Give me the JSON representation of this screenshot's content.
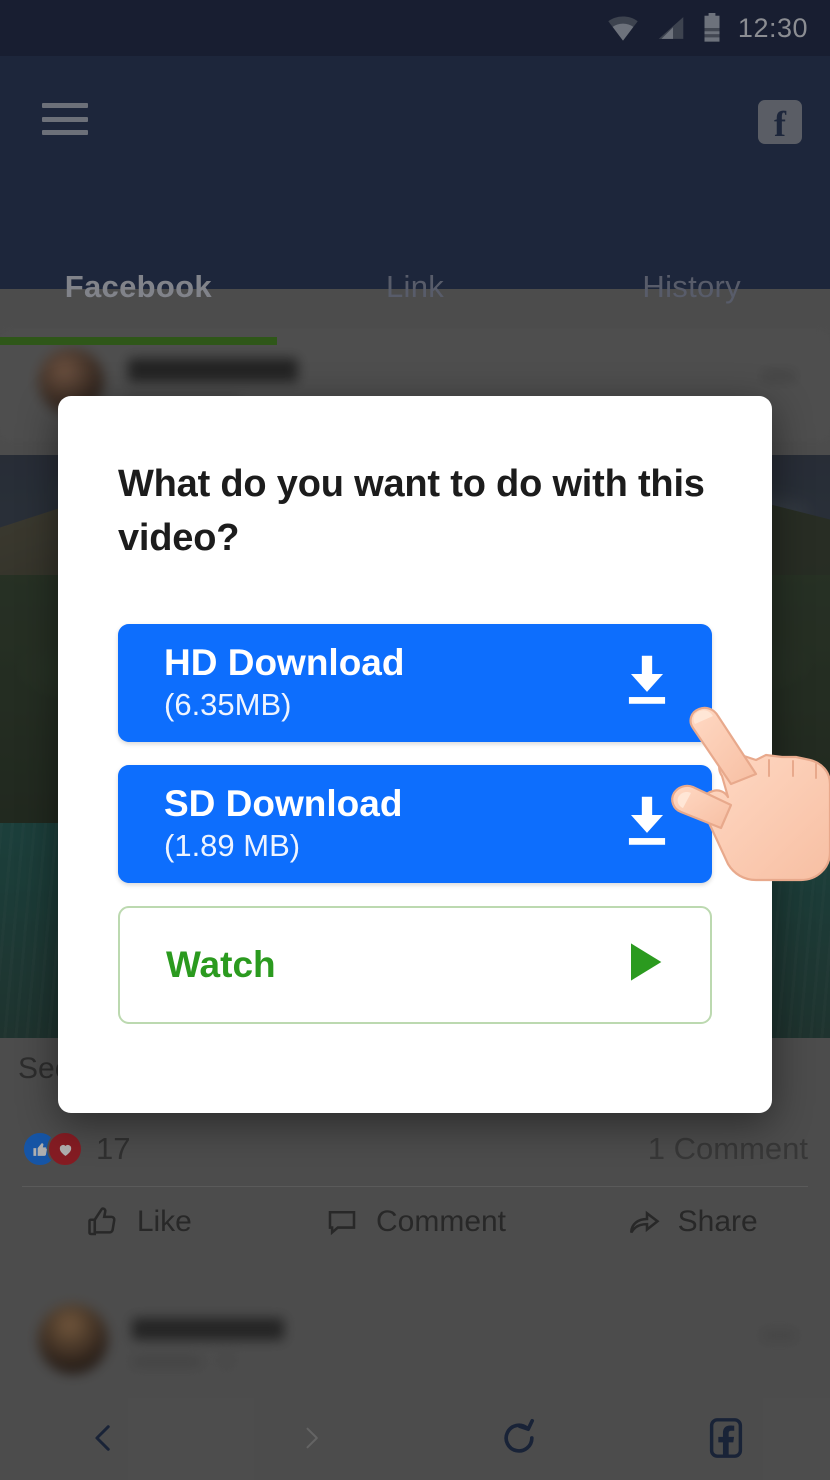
{
  "status_bar": {
    "time": "12:30",
    "icons": [
      "wifi-icon",
      "cellular-signal-icon",
      "battery-icon"
    ]
  },
  "app_bar": {
    "menu_icon": "hamburger-menu-icon",
    "brand_icon": "facebook-logo-icon"
  },
  "tabs": [
    {
      "label": "Facebook",
      "active": true
    },
    {
      "label": "Link",
      "active": false
    },
    {
      "label": "History",
      "active": false
    }
  ],
  "background_post": {
    "see_more": "See",
    "reaction_count": "17",
    "comment_count": "1 Comment",
    "actions": [
      {
        "label": "Like",
        "icon": "thumbs-up-icon"
      },
      {
        "label": "Comment",
        "icon": "comment-bubble-icon"
      },
      {
        "label": "Share",
        "icon": "share-arrow-icon"
      }
    ]
  },
  "dialog": {
    "title": "What do you want to do with this video?",
    "options": [
      {
        "label": "HD Download",
        "size": "(6.35MB)",
        "icon": "download-icon",
        "style": "primary"
      },
      {
        "label": "SD Download",
        "size": "(1.89 MB)",
        "icon": "download-icon",
        "style": "primary"
      }
    ],
    "watch": {
      "label": "Watch",
      "icon": "play-icon"
    }
  },
  "bottom_nav": [
    {
      "icon": "chevron-left-icon",
      "name": "back-button",
      "enabled": true
    },
    {
      "icon": "chevron-right-icon",
      "name": "forward-button",
      "enabled": false
    },
    {
      "icon": "refresh-icon",
      "name": "reload-button",
      "enabled": true
    },
    {
      "icon": "facebook-square-icon",
      "name": "facebook-home-button",
      "enabled": true
    }
  ],
  "colors": {
    "primary_blue": "#0d6efd",
    "accent_green": "#2b9a1f",
    "tab_indicator_green": "#3d7a1c",
    "appbar_navy": "#22304f",
    "statusbar_navy": "#1b2440"
  },
  "pointer_hint": {
    "icon": "pointing-hand-icon",
    "target": "HD Download"
  }
}
